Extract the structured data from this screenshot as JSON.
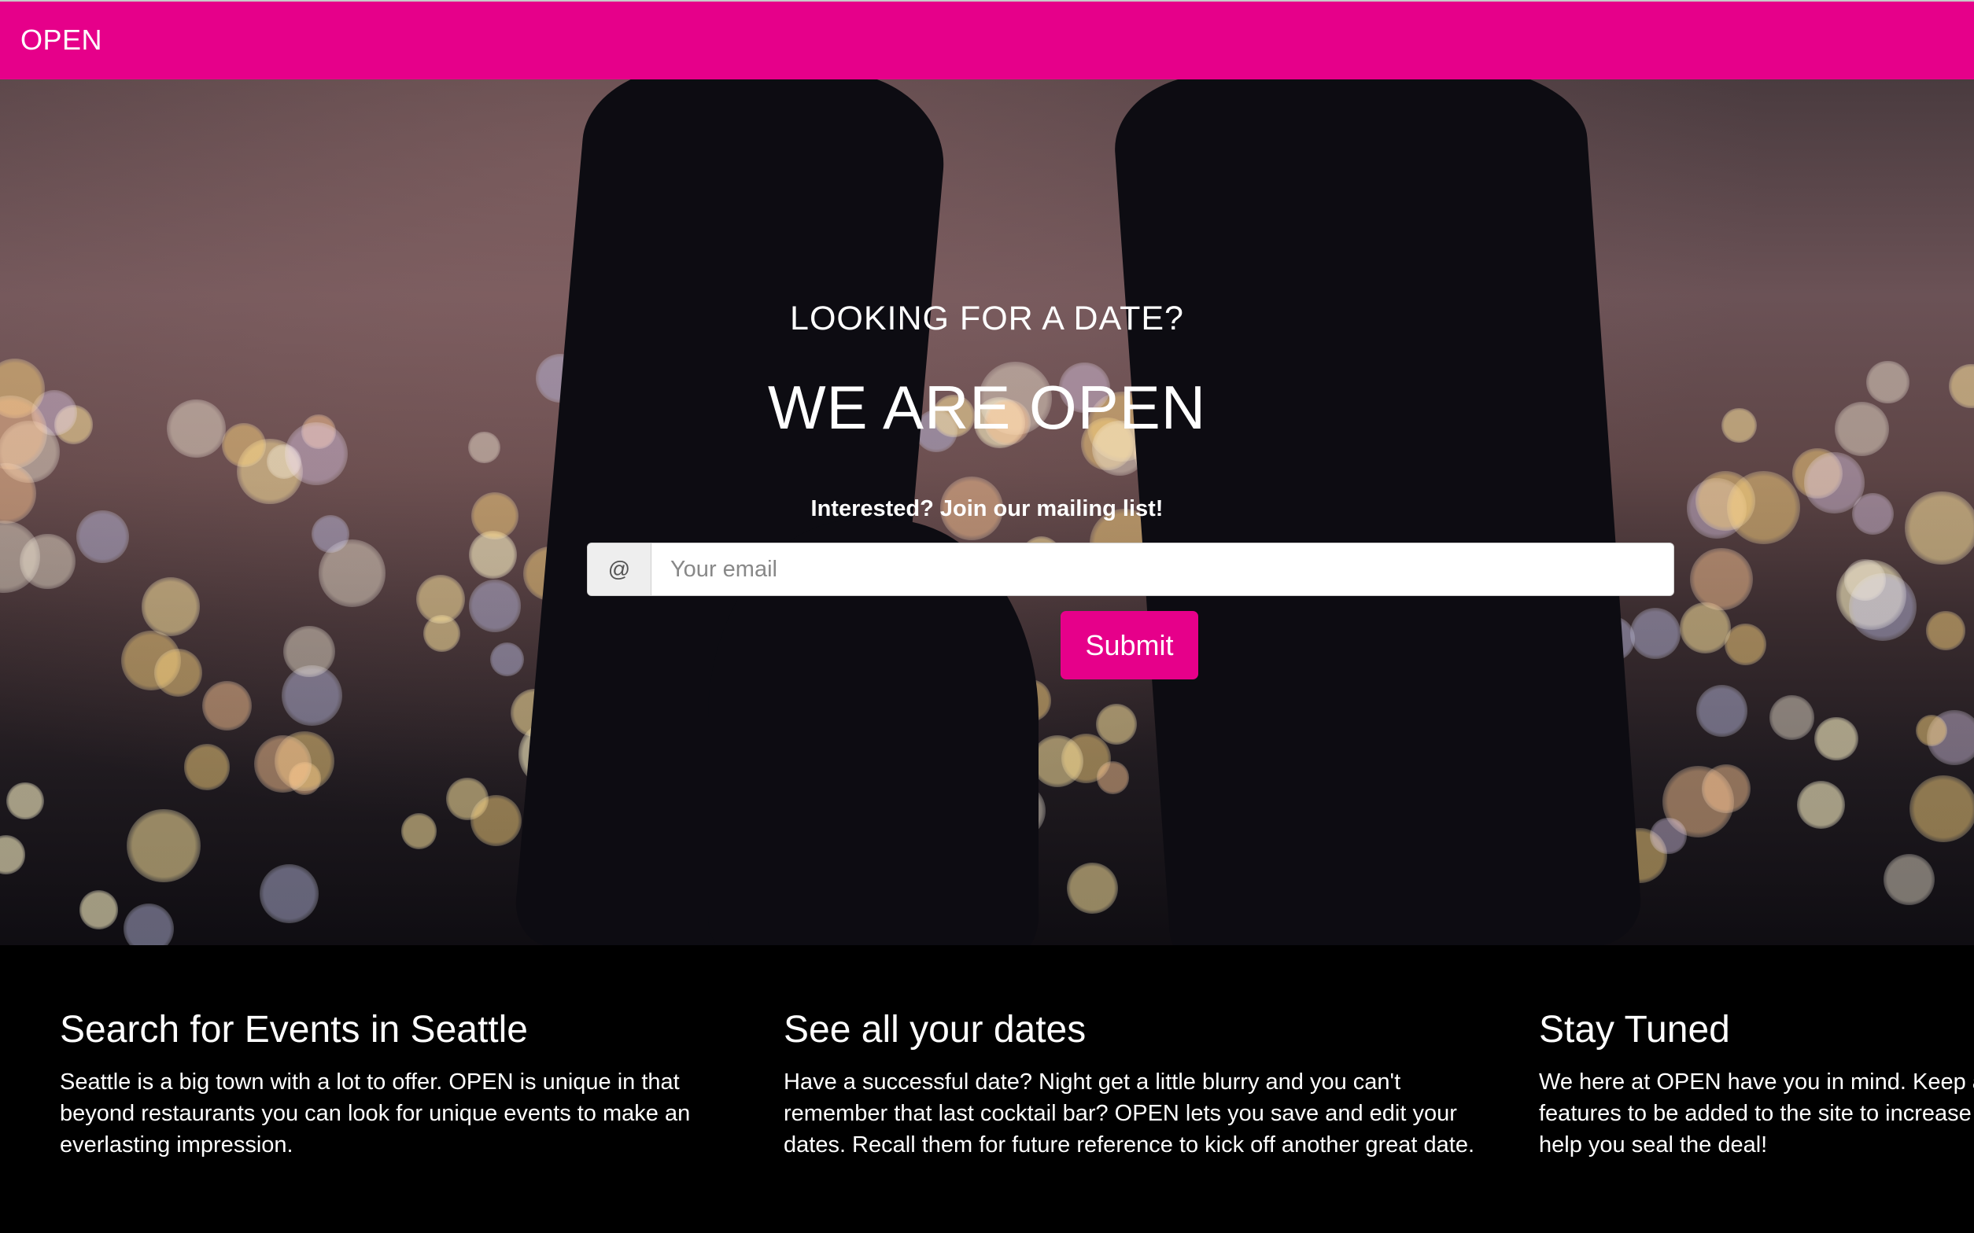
{
  "navbar": {
    "brand": "OPEN",
    "color": "#e6008a"
  },
  "hero": {
    "kicker": "LOOKING FOR A DATE?",
    "headline": "WE ARE OPEN",
    "mailing_label": "Interested? Join our mailing list!",
    "email_addon": "@",
    "email_placeholder": "Your email",
    "submit_label": "Submit",
    "background": "blurred city lights (bokeh) at night with a silhouetted person"
  },
  "features": [
    {
      "title": "Search for Events in Seattle",
      "lines": [
        "Seattle is a big town with a lot to offer. OPEN is unique in that",
        "beyond restaurants you can look for unique events to make an",
        "everlasting impression."
      ]
    },
    {
      "title": "See all your dates",
      "lines": [
        "Have a successful date? Night get a little blurry and you can't",
        "remember that last cocktail bar? OPEN lets you save and edit your",
        "dates. Recall them for future reference to kick off another great date."
      ]
    },
    {
      "title": "Stay Tuned",
      "lines": [
        "We here at OPEN have you in mind. Keep an",
        "features to be added to the site to increase y",
        "help you seal the deal!"
      ]
    }
  ]
}
